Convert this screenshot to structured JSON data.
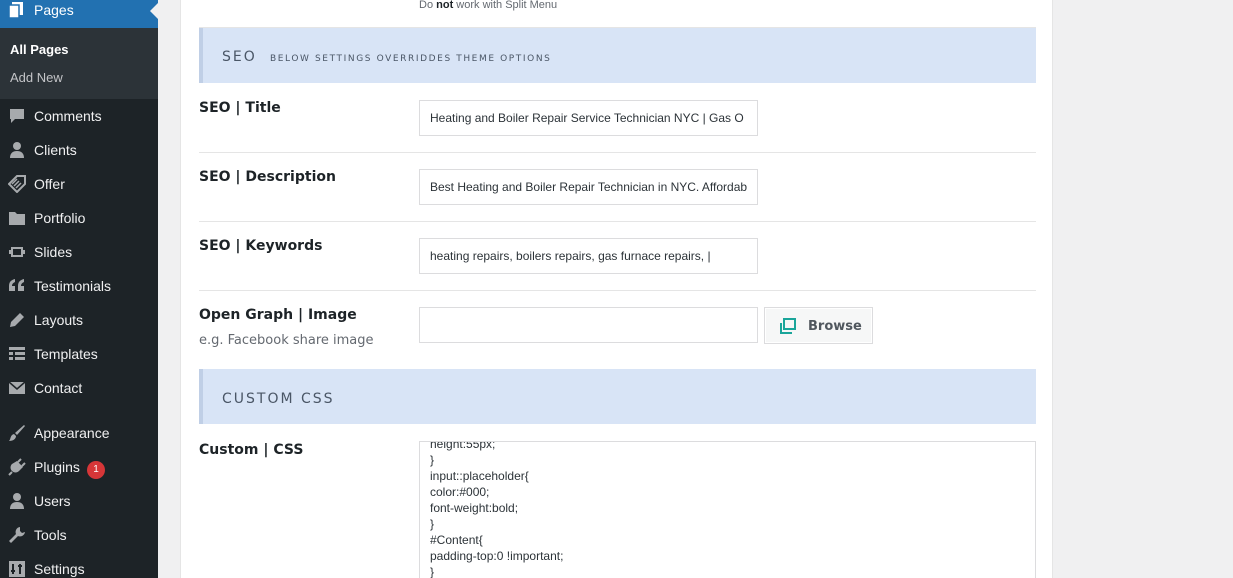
{
  "sidebar": {
    "current": "Pages",
    "submenu": [
      "All Pages",
      "Add New"
    ],
    "items": [
      {
        "label": "Comments",
        "icon": "comment-icon"
      },
      {
        "label": "Clients",
        "icon": "person-icon"
      },
      {
        "label": "Offer",
        "icon": "tag-icon"
      },
      {
        "label": "Portfolio",
        "icon": "folder-icon"
      },
      {
        "label": "Slides",
        "icon": "slides-icon"
      },
      {
        "label": "Testimonials",
        "icon": "quote-icon"
      },
      {
        "label": "Layouts",
        "icon": "pencil-icon"
      },
      {
        "label": "Templates",
        "icon": "grid-icon"
      },
      {
        "label": "Contact",
        "icon": "envelope-icon"
      },
      {
        "label": "Appearance",
        "icon": "brush-icon"
      },
      {
        "label": "Plugins",
        "icon": "plug-icon",
        "badge": "1"
      },
      {
        "label": "Users",
        "icon": "person-icon"
      },
      {
        "label": "Tools",
        "icon": "wrench-icon"
      },
      {
        "label": "Settings",
        "icon": "settings-icon"
      }
    ]
  },
  "note": {
    "prefix": "Do ",
    "bold": "not",
    "suffix": " work with Split Menu"
  },
  "seo_section": {
    "title": "SEO",
    "subtitle": "BELOW SETTINGS OVERRIDDES THEME OPTIONS"
  },
  "fields": {
    "title": {
      "label": "SEO | Title",
      "value": "Heating and Boiler Repair Service Technician NYC |  Gas O"
    },
    "description": {
      "label": "SEO | Description",
      "value": "Best Heating and Boiler Repair Technician in NYC. Affordab"
    },
    "keywords": {
      "label": "SEO | Keywords",
      "value": "heating repairs, boilers repairs, gas furnace repairs, |"
    },
    "og_image": {
      "label": "Open Graph | Image",
      "hint": "e.g. Facebook share image",
      "value": "",
      "browse_label": "Browse"
    }
  },
  "css_section": {
    "title": "CUSTOM CSS"
  },
  "custom_css": {
    "label": "Custom | CSS",
    "lines": [
      "height:55px;",
      "}",
      "input::placeholder{",
      "color:#000;",
      "font-weight:bold;",
      "}",
      "#Content{",
      "padding-top:0 !important;",
      "}"
    ]
  },
  "colors": {
    "sidebar_bg": "#1d2327",
    "active_blue": "#2271b1",
    "section_bg": "#d8e4f6",
    "badge_red": "#d63638",
    "browse_icon_teal": "#1aa59a"
  }
}
